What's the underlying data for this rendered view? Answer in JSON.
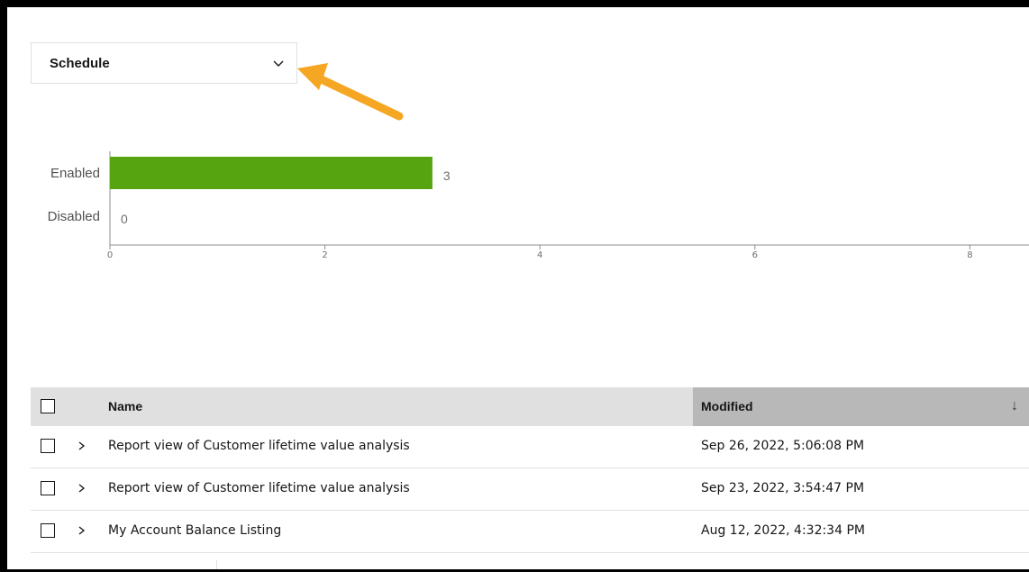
{
  "dropdown": {
    "label": "Schedule"
  },
  "chart_data": {
    "type": "bar",
    "orientation": "horizontal",
    "categories": [
      "Enabled",
      "Disabled"
    ],
    "values": [
      3,
      0
    ],
    "xlim": [
      0,
      9
    ],
    "ticks": [
      "0",
      "2",
      "4",
      "6",
      "8"
    ],
    "bar_color": "#56a510",
    "grid": false
  },
  "table": {
    "columns": {
      "name": "Name",
      "modified": "Modified"
    },
    "sort": {
      "column": "Modified",
      "direction": "descending"
    },
    "rows": [
      {
        "name": "Report view of Customer lifetime value analysis",
        "modified": "Sep 26, 2022, 5:06:08 PM"
      },
      {
        "name": "Report view of Customer lifetime value analysis",
        "modified": "Sep 23, 2022, 3:54:47 PM"
      },
      {
        "name": "My Account Balance Listing",
        "modified": "Aug 12, 2022, 4:32:34 PM"
      }
    ]
  },
  "colors": {
    "arrow": "#f5a623",
    "header_bg": "#e0e0e0",
    "sorted_header_bg": "#b8b8b8"
  }
}
